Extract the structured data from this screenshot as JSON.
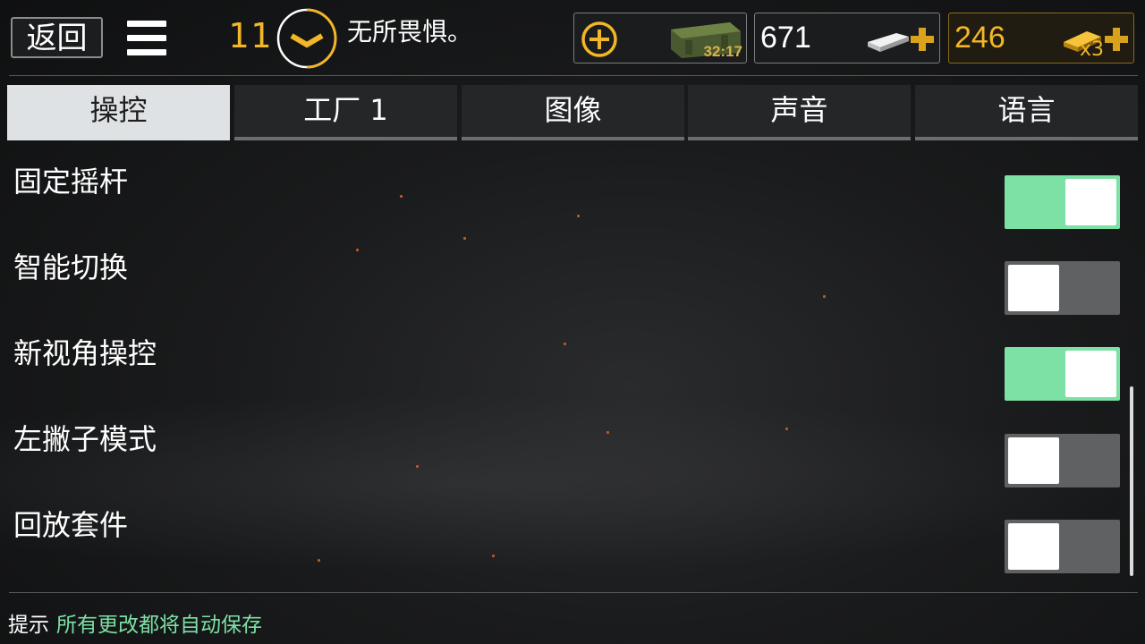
{
  "header": {
    "back_label": "返回",
    "level": "11",
    "player_name": "无所畏惧。",
    "crate_timer": "32:17",
    "silver": "671",
    "gold": "246",
    "gold_multiplier": "x3"
  },
  "tabs": [
    {
      "label": "操控",
      "active": true
    },
    {
      "label": "工厂 1",
      "active": false
    },
    {
      "label": "图像",
      "active": false
    },
    {
      "label": "声音",
      "active": false
    },
    {
      "label": "语言",
      "active": false
    }
  ],
  "settings": [
    {
      "label": "固定摇杆",
      "enabled": true
    },
    {
      "label": "智能切换",
      "enabled": false
    },
    {
      "label": "新视角操控",
      "enabled": true
    },
    {
      "label": "左撇子模式",
      "enabled": false
    },
    {
      "label": "回放套件",
      "enabled": false
    }
  ],
  "footer": {
    "hint_key": "提示",
    "hint_text": "所有更改都将自动保存"
  },
  "colors": {
    "accent_gold": "#f2b628",
    "toggle_on": "#7de0a4",
    "toggle_off": "#5f6163"
  }
}
